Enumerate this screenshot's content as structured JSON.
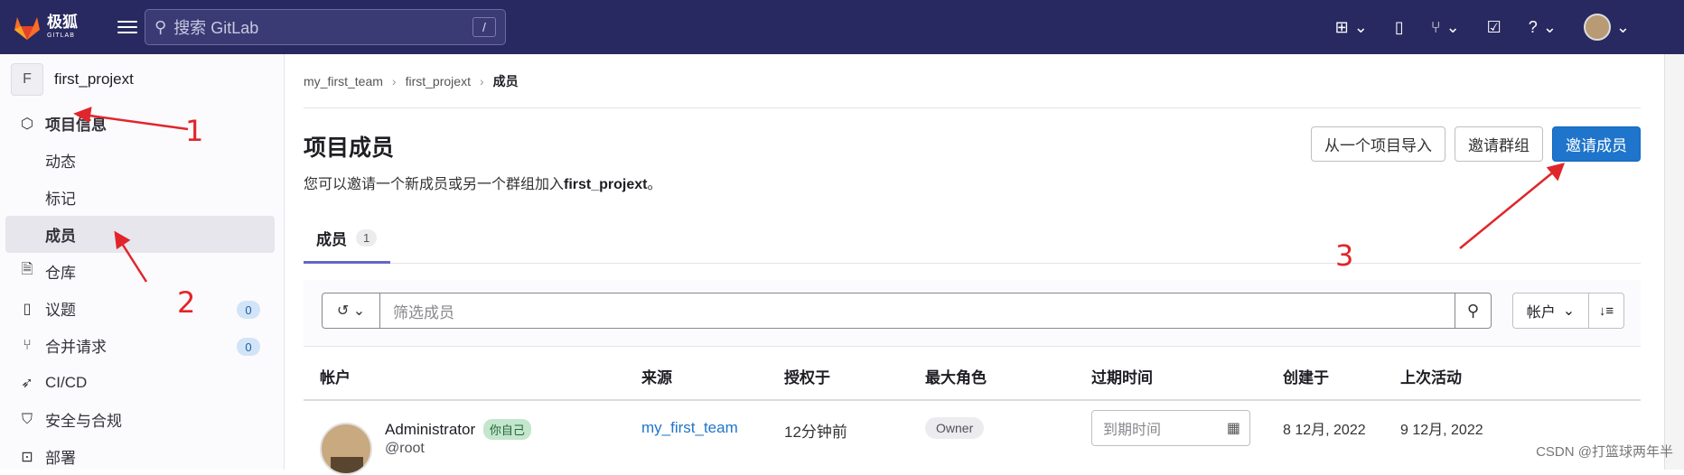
{
  "topbar": {
    "logo_text": "极狐",
    "logo_sub": "GITLAB",
    "search_placeholder": "搜索 GitLab",
    "search_shortcut": "/"
  },
  "sidebar": {
    "project_initial": "F",
    "project_name": "first_projext",
    "items": [
      {
        "label": "项目信息",
        "icon": "info-icon"
      },
      {
        "label": "动态"
      },
      {
        "label": "标记"
      },
      {
        "label": "成员"
      },
      {
        "label": "仓库",
        "icon": "file-icon"
      },
      {
        "label": "议题",
        "icon": "issues-icon",
        "count": "0"
      },
      {
        "label": "合并请求",
        "icon": "merge-request-icon",
        "count": "0"
      },
      {
        "label": "CI/CD",
        "icon": "rocket-icon"
      },
      {
        "label": "安全与合规",
        "icon": "shield-icon"
      },
      {
        "label": "部署",
        "icon": "deploy-icon"
      }
    ]
  },
  "breadcrumb": {
    "items": [
      "my_first_team",
      "first_projext",
      "成员"
    ]
  },
  "page": {
    "title": "项目成员",
    "desc_prefix": "您可以邀请一个新成员或另一个群组加入",
    "desc_project": "first_projext",
    "desc_suffix": "。",
    "btn_import": "从一个项目导入",
    "btn_invite_group": "邀请群组",
    "btn_invite_member": "邀请成员"
  },
  "tabs": [
    {
      "label": "成员",
      "count": "1"
    }
  ],
  "filter": {
    "placeholder": "筛选成员",
    "sort_label": "帐户"
  },
  "table": {
    "headers": [
      "帐户",
      "来源",
      "授权于",
      "最大角色",
      "过期时间",
      "创建于",
      "上次活动"
    ],
    "rows": [
      {
        "name": "Administrator",
        "you_badge": "你自己",
        "handle": "@root",
        "source": "my_first_team",
        "granted": "12分钟前",
        "role": "Owner",
        "expiry_placeholder": "到期时间",
        "created": "8 12月, 2022",
        "last_active": "9 12月, 2022"
      }
    ]
  },
  "annotations": [
    "1",
    "2",
    "3"
  ],
  "watermark": "CSDN @打篮球两年半",
  "colors": {
    "topbar": "#292961",
    "primary": "#1f75cb",
    "annotation": "#e0262b"
  }
}
